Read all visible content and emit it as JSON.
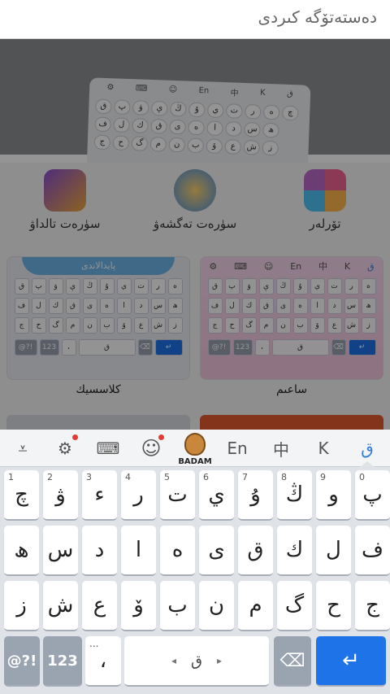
{
  "header": {
    "title": "دەستەتۆگە كىردى"
  },
  "categories": [
    {
      "label": "تۆرلەر"
    },
    {
      "label": "سۈرەت تەگشەۋ"
    },
    {
      "label": "سۈرەت تالداۋ"
    }
  ],
  "hero": {
    "preview_rows": [
      [
        "ق",
        "پ",
        "ۋ",
        "ې",
        "ڭ",
        "ۇ",
        "ي",
        "ت",
        "ر",
        "ە",
        "چ"
      ],
      [
        "ف",
        "ل",
        "ك",
        "ق",
        "ى",
        "ە",
        "ا",
        "د",
        "س",
        "ھ"
      ],
      [
        "ج",
        "ح",
        "گ",
        "م",
        "ن",
        "ب",
        "ۆ",
        "ع",
        "ش",
        "ز"
      ]
    ]
  },
  "themes": [
    {
      "label": "ساعىم",
      "accent": "#e9a3d8"
    },
    {
      "label": "كلاسسيك",
      "accent": "#6fb6e8",
      "banner": "پايدالاندى"
    }
  ],
  "keyboard": {
    "toolbar": {
      "items": [
        {
          "name": "collapse-icon",
          "glyph": "⩡"
        },
        {
          "name": "settings-icon",
          "glyph": "⚙"
        },
        {
          "name": "keyboard-icon",
          "glyph": "⌨"
        },
        {
          "name": "emoji-icon",
          "glyph": "☺"
        },
        {
          "name": "badam-icon",
          "glyph": "",
          "label": "BADAM"
        },
        {
          "name": "english-icon",
          "glyph": "En"
        },
        {
          "name": "chinese-icon",
          "glyph": "中"
        },
        {
          "name": "kazakh-icon",
          "glyph": "K"
        },
        {
          "name": "uyghur-icon",
          "glyph": "ق"
        }
      ]
    },
    "row1": [
      {
        "label": "چ",
        "num": "1"
      },
      {
        "label": "ۋ",
        "num": "2"
      },
      {
        "label": "ء",
        "num": "3"
      },
      {
        "label": "ر",
        "num": "4"
      },
      {
        "label": "ت",
        "num": "5"
      },
      {
        "label": "ي",
        "num": "6"
      },
      {
        "label": "ۇ",
        "num": "7"
      },
      {
        "label": "ڭ",
        "num": "8"
      },
      {
        "label": "و",
        "num": "9"
      },
      {
        "label": "پ",
        "num": "0"
      }
    ],
    "row2": [
      "ھ",
      "س",
      "د",
      "ا",
      "ە",
      "ى",
      "ق",
      "ك",
      "ل",
      "ف"
    ],
    "row3": [
      "ز",
      "ش",
      "ع",
      "ۆ",
      "ب",
      "ن",
      "م",
      "گ",
      "ح",
      "ج"
    ],
    "bottom": {
      "symbols": "@?!",
      "numbers": "123",
      "punct": "،",
      "punct_hint": "...",
      "space": "ق",
      "space_arrows_left": "◂",
      "space_arrows_right": "▸",
      "backspace": "⌫",
      "enter": "↵"
    },
    "colors": {
      "accent": "#1e73e8",
      "dark_key": "#9aa3b0"
    }
  }
}
